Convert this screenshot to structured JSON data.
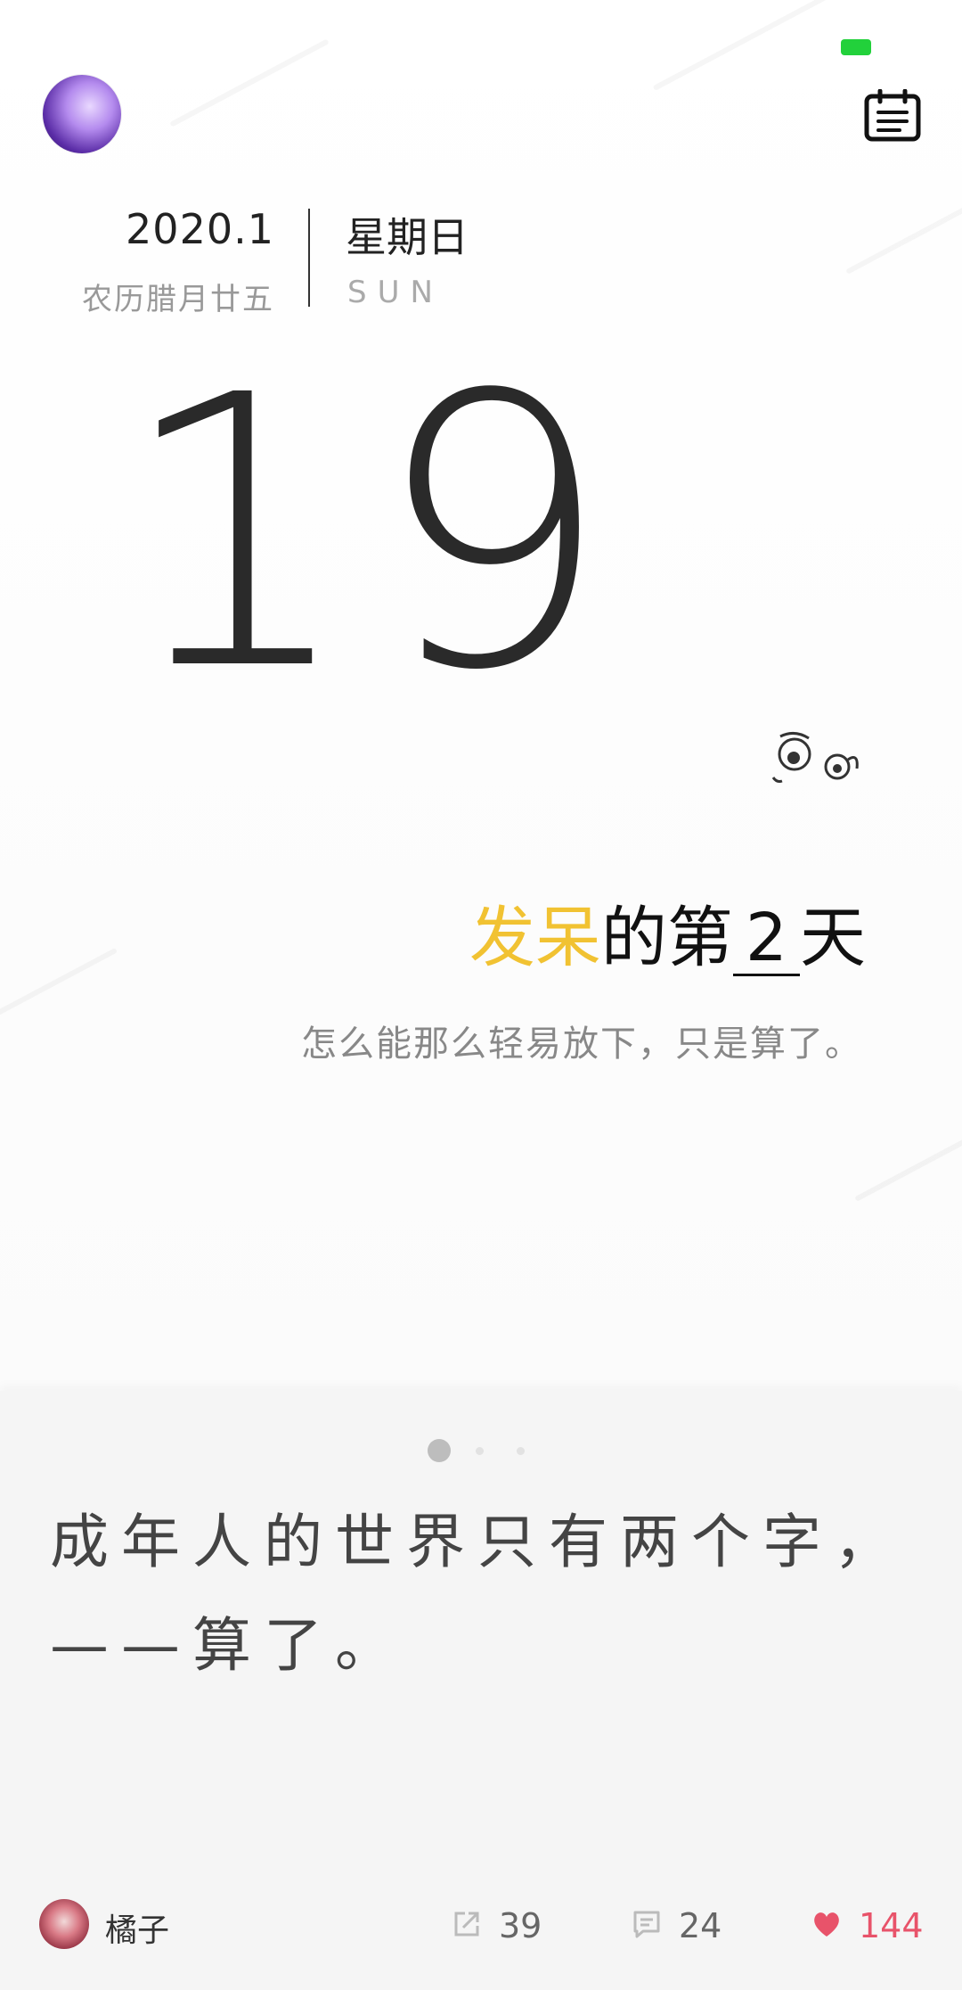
{
  "status": {
    "battery_color": "#22d13b"
  },
  "header": {
    "avatar_icon": "user-avatar",
    "calendar_icon": "calendar-list-icon"
  },
  "date": {
    "year_month": "2020.1",
    "lunar": "农历腊月廿五",
    "weekday": "星期日",
    "weekday_en": "SUN",
    "day": "19"
  },
  "headline": {
    "highlight": "发呆",
    "middle": "的第",
    "count": "2",
    "suffix": "天",
    "highlight_color": "#f1c232"
  },
  "subline": "怎么能那么轻易放下，只是算了。",
  "pager": {
    "active_index": 0,
    "count": 3
  },
  "quote": {
    "line1": "成年人的世界只有两个字，",
    "line2": "——算了。"
  },
  "footer": {
    "author": "橘子",
    "share_icon": "share-icon",
    "share_count": "39",
    "comment_icon": "comment-icon",
    "comment_count": "24",
    "like_icon": "heart-icon",
    "like_count": "144",
    "like_color": "#e8536a"
  }
}
